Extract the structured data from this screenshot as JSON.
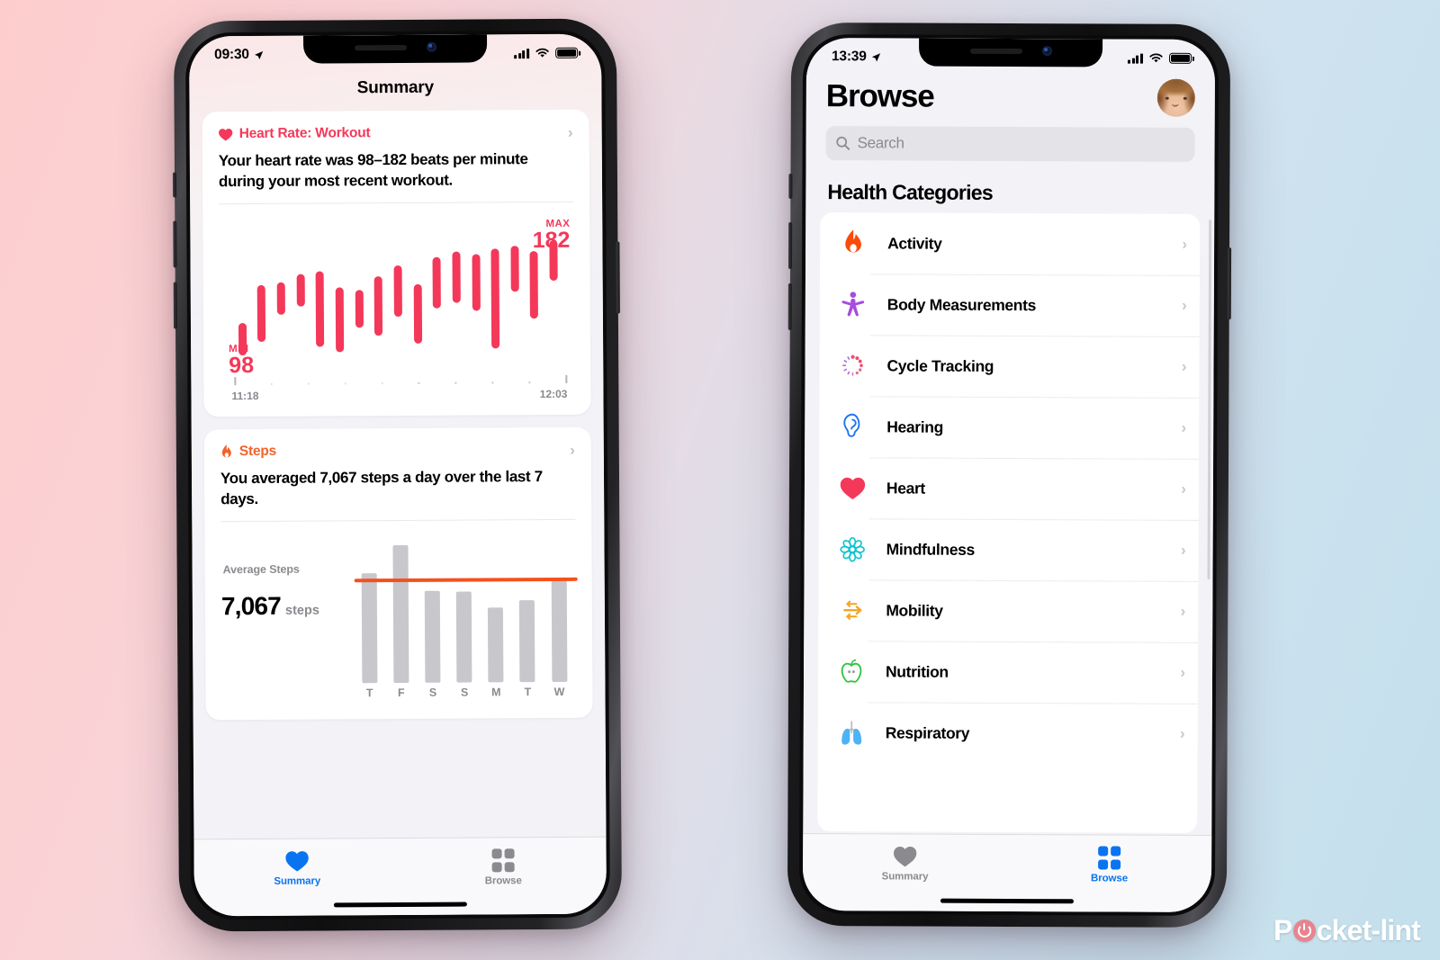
{
  "background": {
    "from": "#fdcdcd",
    "to": "#c3e0ec"
  },
  "watermark": {
    "before": "P",
    "after": "cket-lint"
  },
  "phone1": {
    "status": {
      "time": "09:30",
      "battery": "full",
      "signal": 4
    },
    "nav_title": "Summary",
    "tabs": [
      {
        "label": "Summary",
        "icon": "heart-icon",
        "active": true,
        "color": "#0a74f0"
      },
      {
        "label": "Browse",
        "icon": "grid-icon",
        "active": false,
        "color": "#8a8a8f"
      }
    ],
    "heart_card": {
      "icon": "heart-icon",
      "title": "Heart Rate: Workout",
      "accent": "#f4385a",
      "description": "Your heart rate was 98–182 beats per minute during your most recent workout.",
      "chevron": "›"
    },
    "steps_card": {
      "icon": "flame-icon",
      "title": "Steps",
      "accent": "#f3622b",
      "description": "You averaged 7,067 steps a day over the last 7 days.",
      "chevron": "›",
      "avg_label": "Average Steps",
      "avg_value": "7,067",
      "avg_unit": "steps"
    }
  },
  "phone2": {
    "status": {
      "time": "13:39",
      "battery": "full",
      "signal": 4
    },
    "title": "Browse",
    "avatar": "user-avatar",
    "search": {
      "placeholder": "Search",
      "icon": "search-icon"
    },
    "section_title": "Health Categories",
    "categories": [
      {
        "label": "Activity",
        "icon": "flame-icon",
        "color": "#fb4b0a"
      },
      {
        "label": "Body Measurements",
        "icon": "body-icon",
        "color": "#a64ce0"
      },
      {
        "label": "Cycle Tracking",
        "icon": "cycle-icon",
        "color": "#ef4b6b"
      },
      {
        "label": "Hearing",
        "icon": "ear-icon",
        "color": "#1f74f0"
      },
      {
        "label": "Heart",
        "icon": "heart-icon",
        "color": "#f4385a"
      },
      {
        "label": "Mindfulness",
        "icon": "mindfulness-icon",
        "color": "#13c4cf"
      },
      {
        "label": "Mobility",
        "icon": "mobility-icon",
        "color": "#f5a623"
      },
      {
        "label": "Nutrition",
        "icon": "apple-icon",
        "color": "#34c546"
      },
      {
        "label": "Respiratory",
        "icon": "lungs-icon",
        "color": "#4eb3f5"
      }
    ],
    "chevron": "›",
    "tabs": [
      {
        "label": "Summary",
        "icon": "heart-icon",
        "active": false,
        "color": "#8a8a8f"
      },
      {
        "label": "Browse",
        "icon": "grid-icon",
        "active": true,
        "color": "#0a74f0"
      }
    ]
  },
  "chart_data": [
    {
      "type": "bar",
      "name": "heart-rate-range",
      "title": "Heart Rate: Workout",
      "unit": "beats per minute",
      "color": "#f4385a",
      "ylim": [
        90,
        190
      ],
      "min_label": "MIN",
      "min_value": 98,
      "max_label": "MAX",
      "max_value": 182,
      "x_start": "11:18",
      "x_end": "12:03",
      "ranges": [
        [
          98,
          122
        ],
        [
          108,
          150
        ],
        [
          128,
          152
        ],
        [
          134,
          158
        ],
        [
          104,
          160
        ],
        [
          100,
          148
        ],
        [
          118,
          146
        ],
        [
          112,
          156
        ],
        [
          126,
          164
        ],
        [
          106,
          150
        ],
        [
          132,
          170
        ],
        [
          136,
          174
        ],
        [
          130,
          172
        ],
        [
          102,
          176
        ],
        [
          144,
          178
        ],
        [
          124,
          174
        ],
        [
          152,
          182
        ]
      ]
    },
    {
      "type": "bar",
      "name": "average-steps",
      "title": "Average Steps",
      "ylabel": "steps",
      "color": "#c7c7cc",
      "average_line": 7067,
      "average_color": "#f4511e",
      "categories": [
        "T",
        "F",
        "S",
        "S",
        "M",
        "T",
        "W"
      ],
      "values": [
        7650,
        9600,
        6400,
        6350,
        5200,
        5700,
        7300
      ],
      "ylim": [
        0,
        10400
      ]
    }
  ]
}
